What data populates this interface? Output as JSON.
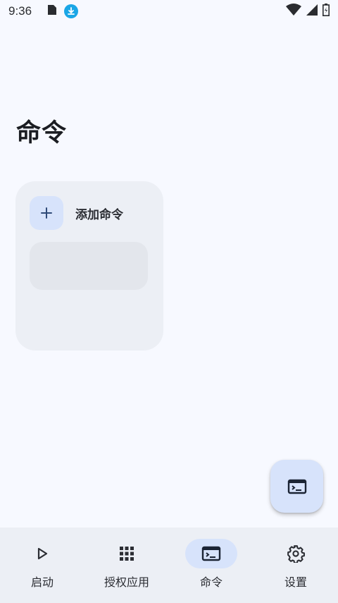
{
  "status_bar": {
    "time": "9:36",
    "icons": [
      "sim-card-icon",
      "download-icon",
      "wifi-icon",
      "signal-icon",
      "battery-icon"
    ]
  },
  "page": {
    "title": "命令"
  },
  "card": {
    "add_label": "添加命令"
  },
  "fab": {
    "icon": "terminal-icon"
  },
  "bottom_nav": {
    "items": [
      {
        "label": "启动",
        "icon": "play-icon",
        "active": false
      },
      {
        "label": "授权应用",
        "icon": "apps-grid-icon",
        "active": false
      },
      {
        "label": "命令",
        "icon": "terminal-icon",
        "active": true
      },
      {
        "label": "设置",
        "icon": "gear-icon",
        "active": false
      }
    ]
  },
  "colors": {
    "background": "#f7f9ff",
    "surface": "#eceff5",
    "accent_container": "#d7e3fb",
    "download_badge": "#1aa6e6"
  }
}
